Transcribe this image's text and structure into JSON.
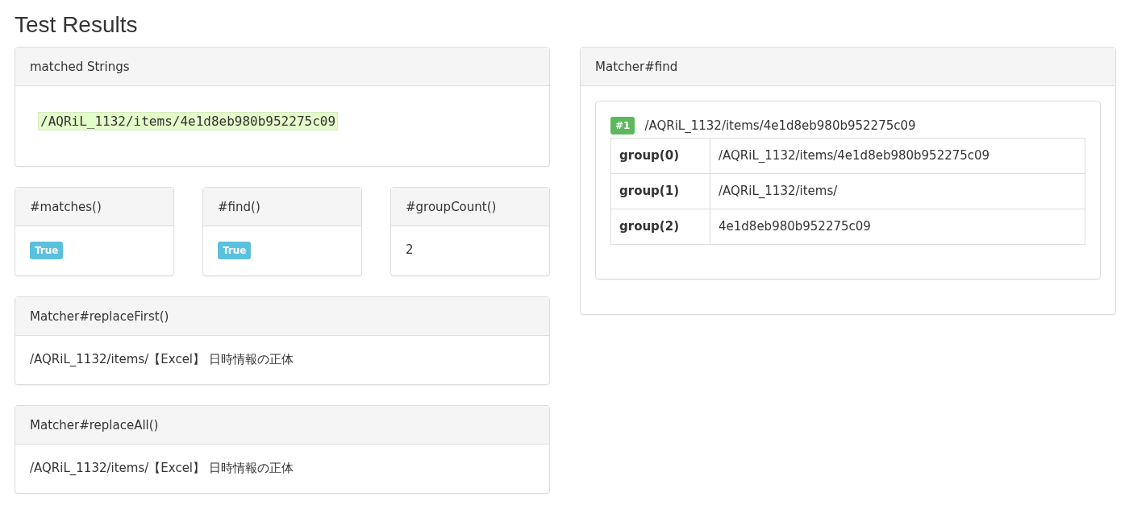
{
  "title": "Test Results",
  "matched_strings": {
    "heading": "matched Strings",
    "value": "/AQRiL_1132/items/4e1d8eb980b952275c09"
  },
  "results": [
    {
      "heading": "#matches()",
      "kind": "badge",
      "value": "True"
    },
    {
      "heading": "#find()",
      "kind": "badge",
      "value": "True"
    },
    {
      "heading": "#groupCount()",
      "kind": "text",
      "value": "2"
    }
  ],
  "replacements": [
    {
      "heading": "Matcher#replaceFirst()",
      "value": "/AQRiL_1132/items/【Excel】 日時情報の正体"
    },
    {
      "heading": "Matcher#replaceAll()",
      "value": "/AQRiL_1132/items/【Excel】 日時情報の正体"
    }
  ],
  "find": {
    "heading": "Matcher#find",
    "matches": [
      {
        "badge": "#1",
        "value": "/AQRiL_1132/items/4e1d8eb980b952275c09",
        "groups": [
          {
            "name": "group(0)",
            "value": "/AQRiL_1132/items/4e1d8eb980b952275c09"
          },
          {
            "name": "group(1)",
            "value": "/AQRiL_1132/items/"
          },
          {
            "name": "group(2)",
            "value": "4e1d8eb980b952275c09"
          }
        ]
      }
    ]
  }
}
